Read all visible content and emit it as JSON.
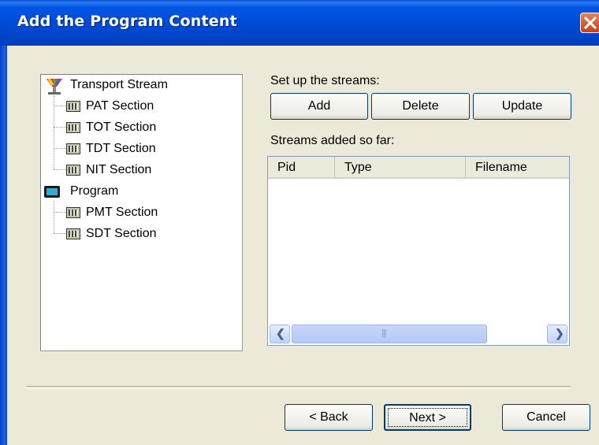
{
  "window": {
    "title": "Add the Program Content"
  },
  "tree": {
    "root_label": "Transport Stream",
    "root_children": [
      "PAT Section",
      "TOT Section",
      "TDT Section",
      "NIT Section"
    ],
    "program_label": "Program",
    "program_children": [
      "PMT Section",
      "SDT Section"
    ]
  },
  "streams": {
    "setup_label": "Set up the streams:",
    "add_label": "Add",
    "delete_label": "Delete",
    "update_label": "Update",
    "added_label": "Streams added so far:",
    "columns": [
      "Pid",
      "Type",
      "Filename"
    ],
    "rows": []
  },
  "footer": {
    "back_label": "< Back",
    "next_label": "Next >",
    "cancel_label": "Cancel"
  }
}
